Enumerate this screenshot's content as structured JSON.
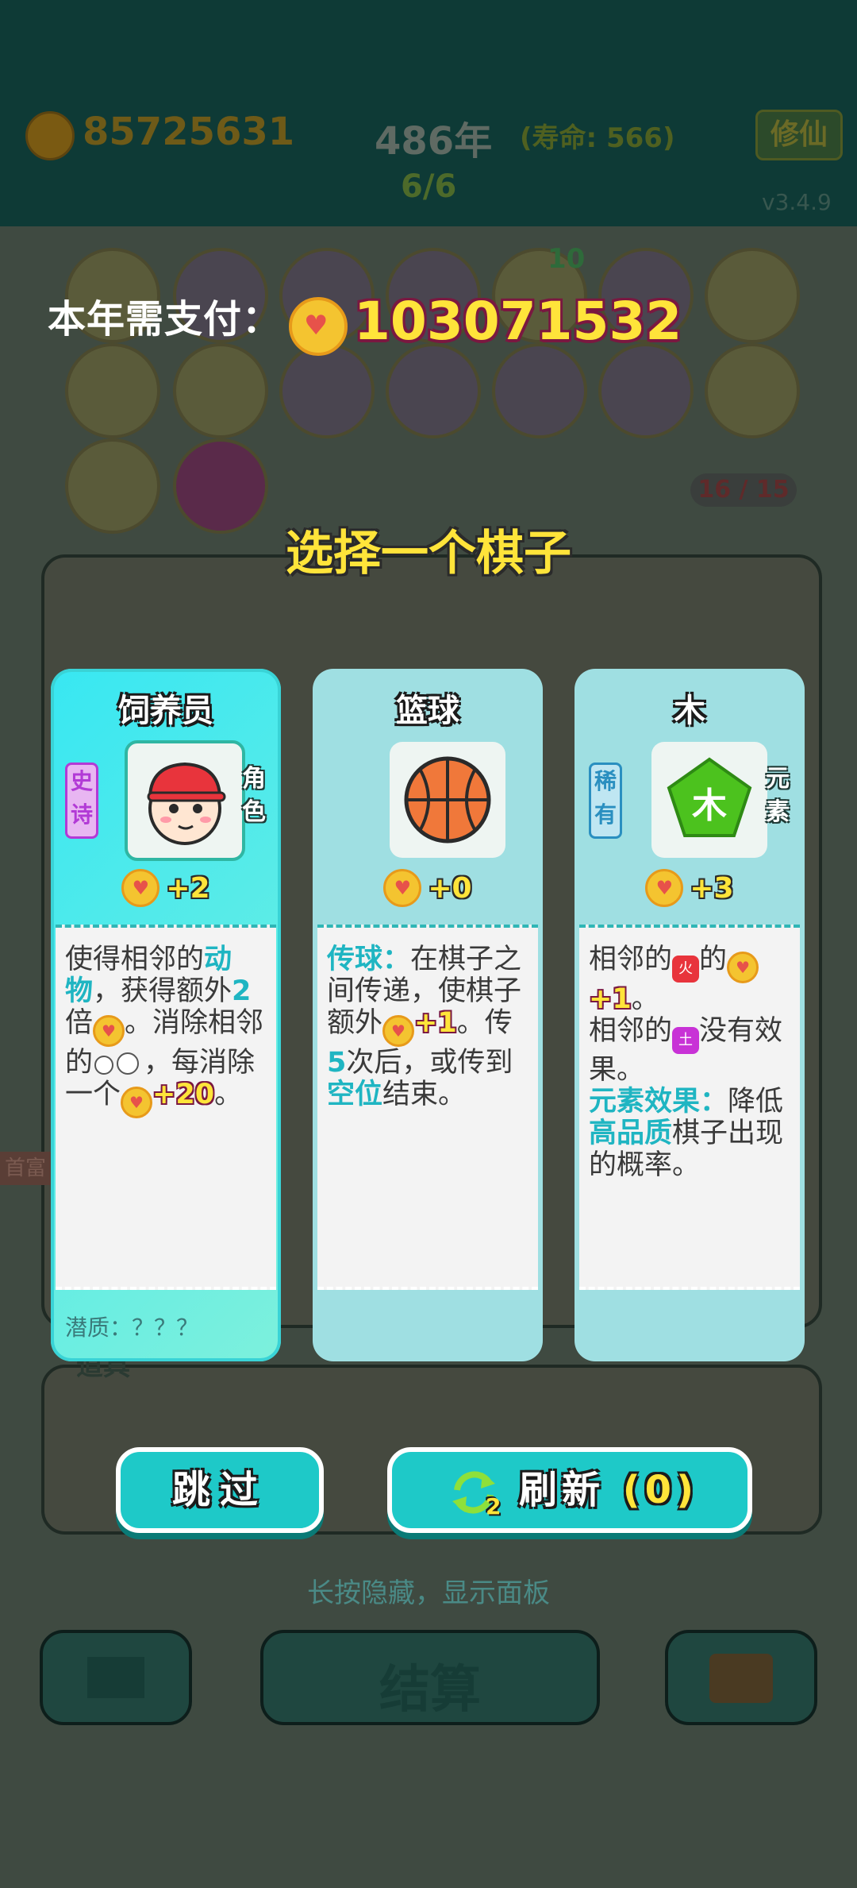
{
  "background": {
    "money": "85725631",
    "year": "486年",
    "lifespan": "(寿命: 566)",
    "cultivate_button": "修仙",
    "round": "6/6",
    "version": "v3.4.9",
    "inventory_count": "16 / 15",
    "badge_count": "10",
    "side_tab": "首富",
    "settle_button": "结算",
    "tools_title": "道具"
  },
  "payment": {
    "label": "本年需支付：",
    "amount": "103071532"
  },
  "prompt": "选择一个棋子",
  "cards": [
    {
      "name": "饲养员",
      "rarity": "史诗",
      "type": "角色",
      "bonus": "+2",
      "desc": {
        "t1": "使得相邻的",
        "h1": "动物",
        "t2": "，获得额外",
        "h2": "2",
        "t3": "倍",
        "t4": "。消除相邻的",
        "t5": "，每消除一个",
        "h3": "+20",
        "t6": "。"
      },
      "potential": "潜质：？？？"
    },
    {
      "name": "篮球",
      "bonus": "+0",
      "desc": {
        "h1": "传球：",
        "t1": "在棋子之间传递，使棋子额外",
        "h2": "+1",
        "t2": "。传",
        "h3": "5",
        "t3": "次后，或传到",
        "h4": "空位",
        "t4": "结束。"
      }
    },
    {
      "name": "木",
      "rarity": "稀有",
      "type": "元素",
      "icon_char": "木",
      "bonus": "+3",
      "desc": {
        "t1": "相邻的",
        "fire": "火",
        "t2": "的",
        "h1": "+1",
        "t3": "。",
        "t4": "相邻的",
        "earth": "土",
        "t5": "没有效果。",
        "h2": "元素效果：",
        "t6": "降低",
        "h3": "高品质",
        "t7": "棋子出现的概率。"
      }
    }
  ],
  "buttons": {
    "skip": "跳过",
    "refresh_label": "刷新",
    "refresh_count": "(0)",
    "refresh_badge": "2"
  },
  "hint": "长按隐藏，显示面板",
  "colors": {
    "accent_cyan": "#1ec9c8",
    "gold": "#ffe43a",
    "highlight_text": "#1fb5c2"
  }
}
